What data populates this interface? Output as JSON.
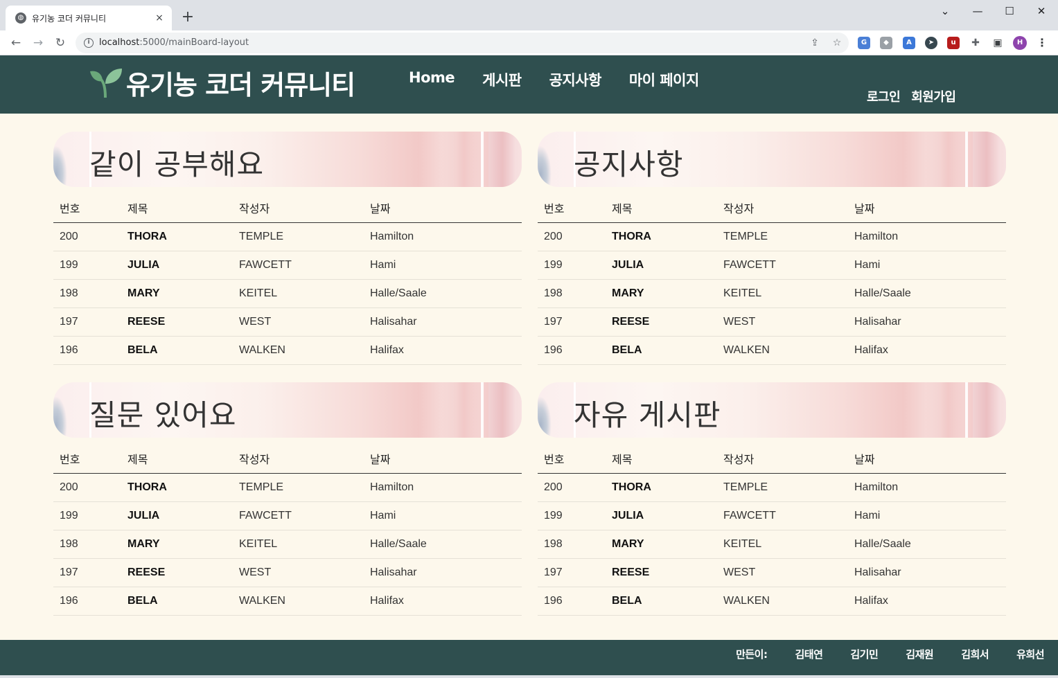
{
  "browser": {
    "tab_title": "유기농 코더 커뮤니티",
    "tab_close": "×",
    "new_tab": "+",
    "url_host": "localhost",
    "url_rest": ":5000/mainBoard-layout",
    "window_controls": {
      "collapse": "⌄",
      "minimize": "—",
      "maximize": "☐",
      "close": "✕"
    },
    "nav": {
      "back": "←",
      "forward": "→",
      "reload": "↻"
    },
    "profile_initial": "H"
  },
  "site": {
    "logo_text": "유기농 코더 커뮤니티",
    "nav": [
      "Home",
      "게시판",
      "공지사항",
      "마이 페이지"
    ],
    "auth": {
      "login": "로그인",
      "signup": "회원가입"
    },
    "colors": {
      "header_bg": "#2f4f4f",
      "page_bg": "#fdf8ec",
      "accent_leaf": "#6aa87a"
    }
  },
  "table_headers": [
    "번호",
    "제목",
    "작성자",
    "날짜"
  ],
  "boards": [
    {
      "title": "같이 공부해요",
      "rows": [
        [
          "200",
          "THORA",
          "TEMPLE",
          "Hamilton"
        ],
        [
          "199",
          "JULIA",
          "FAWCETT",
          "Hami"
        ],
        [
          "198",
          "MARY",
          "KEITEL",
          "Halle/Saale"
        ],
        [
          "197",
          "REESE",
          "WEST",
          "Halisahar"
        ],
        [
          "196",
          "BELA",
          "WALKEN",
          "Halifax"
        ]
      ]
    },
    {
      "title": "공지사항",
      "rows": [
        [
          "200",
          "THORA",
          "TEMPLE",
          "Hamilton"
        ],
        [
          "199",
          "JULIA",
          "FAWCETT",
          "Hami"
        ],
        [
          "198",
          "MARY",
          "KEITEL",
          "Halle/Saale"
        ],
        [
          "197",
          "REESE",
          "WEST",
          "Halisahar"
        ],
        [
          "196",
          "BELA",
          "WALKEN",
          "Halifax"
        ]
      ]
    },
    {
      "title": "질문 있어요",
      "rows": [
        [
          "200",
          "THORA",
          "TEMPLE",
          "Hamilton"
        ],
        [
          "199",
          "JULIA",
          "FAWCETT",
          "Hami"
        ],
        [
          "198",
          "MARY",
          "KEITEL",
          "Halle/Saale"
        ],
        [
          "197",
          "REESE",
          "WEST",
          "Halisahar"
        ],
        [
          "196",
          "BELA",
          "WALKEN",
          "Halifax"
        ]
      ]
    },
    {
      "title": "자유 게시판",
      "rows": [
        [
          "200",
          "THORA",
          "TEMPLE",
          "Hamilton"
        ],
        [
          "199",
          "JULIA",
          "FAWCETT",
          "Hami"
        ],
        [
          "198",
          "MARY",
          "KEITEL",
          "Halle/Saale"
        ],
        [
          "197",
          "REESE",
          "WEST",
          "Halisahar"
        ],
        [
          "196",
          "BELA",
          "WALKEN",
          "Halifax"
        ]
      ]
    }
  ],
  "footer": {
    "label": "만든이:",
    "names": [
      "김태연",
      "김기민",
      "김재원",
      "김희서",
      "유희선"
    ]
  }
}
